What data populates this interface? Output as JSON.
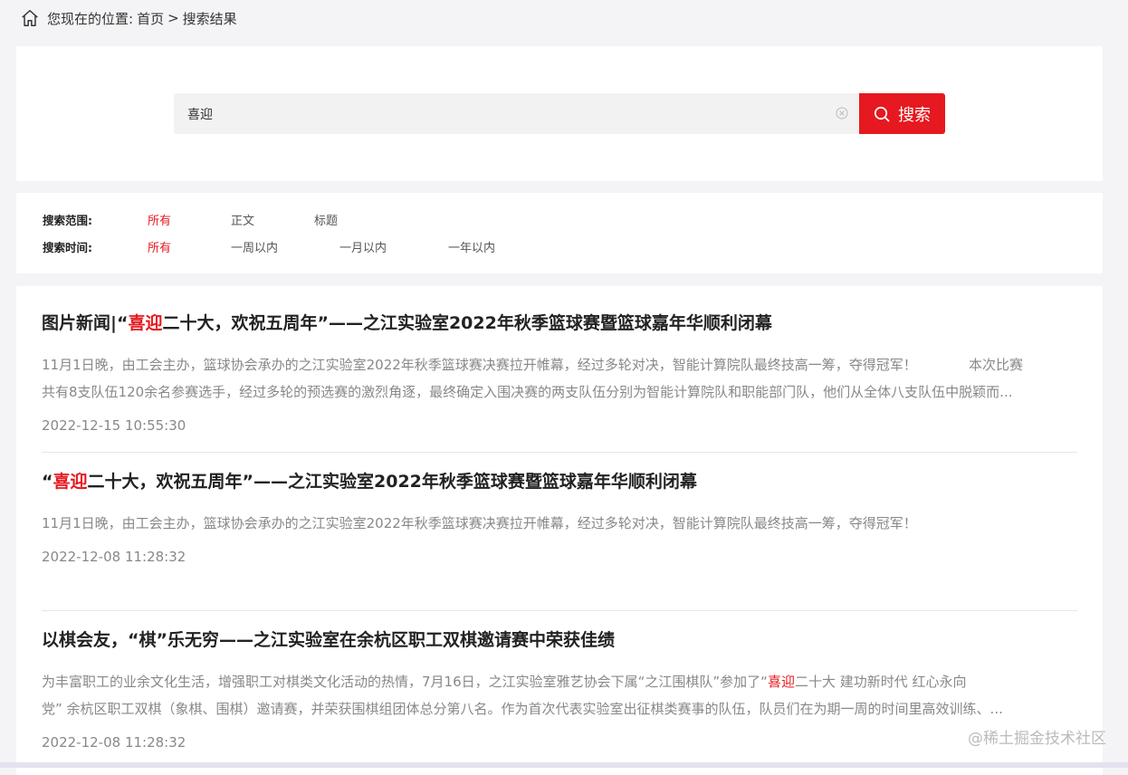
{
  "breadcrumb": {
    "prefix": "您现在的位置:",
    "home": "首页",
    "separator": ">",
    "current": "搜索结果"
  },
  "search": {
    "value": "喜迎",
    "button_label": "搜索"
  },
  "filters": {
    "range_label": "搜索范围:",
    "range_options": [
      "所有",
      "正文",
      "标题"
    ],
    "time_label": "搜索时间:",
    "time_options": [
      "所有",
      "一周以内",
      "一月以内",
      "一年以内"
    ],
    "active_color": "#e5191f"
  },
  "results": [
    {
      "title_pre": "图片新闻|“",
      "title_hl": "喜迎",
      "title_post": "二十大，欢祝五周年”——之江实验室2022年秋季篮球赛暨篮球嘉年华顺利闭幕",
      "summary_lines": [
        "11月1日晚，由工会主办，篮球协会承办的之江实验室2022年秋季篮球赛决赛拉开帷幕，经过多轮对决，智能计算院队最终技高一筹，夺得冠军！            本次比赛",
        "共有8支队伍120余名参赛选手，经过多轮的预选赛的激烈角逐，最终确定入围决赛的两支队伍分别为智能计算院队和职能部门队，他们从全体八支队伍中脱颖而..."
      ],
      "date": "2022-12-15 10:55:30"
    },
    {
      "title_pre": "“",
      "title_hl": "喜迎",
      "title_post": "二十大，欢祝五周年”——之江实验室2022年秋季篮球赛暨篮球嘉年华顺利闭幕",
      "summary_lines": [
        "11月1日晚，由工会主办，篮球协会承办的之江实验室2022年秋季篮球赛决赛拉开帷幕，经过多轮对决，智能计算院队最终技高一筹，夺得冠军！"
      ],
      "date": "2022-12-08 11:28:32"
    },
    {
      "title": "以棋会友，“棋”乐无穷——之江实验室在余杭区职工双棋邀请赛中荣获佳绩",
      "summary_line1_pre": "为丰富职工的业余文化生活，增强职工对棋类文化活动的热情，7月16日，之江实验室雅艺协会下属“之江围棋队”参加了“",
      "summary_line1_hl": "喜迎",
      "summary_line1_post": "二十大 建功新时代 红心永向",
      "summary_line2": "党” 余杭区职工双棋（象棋、围棋）邀请赛，并荣获围棋组团体总分第八名。作为首次代表实验室出征棋类赛事的队伍，队员们在为期一周的时间里高效训练、...",
      "date": "2022-12-08 11:28:32"
    }
  ],
  "watermark": "@稀土掘金技术社区"
}
